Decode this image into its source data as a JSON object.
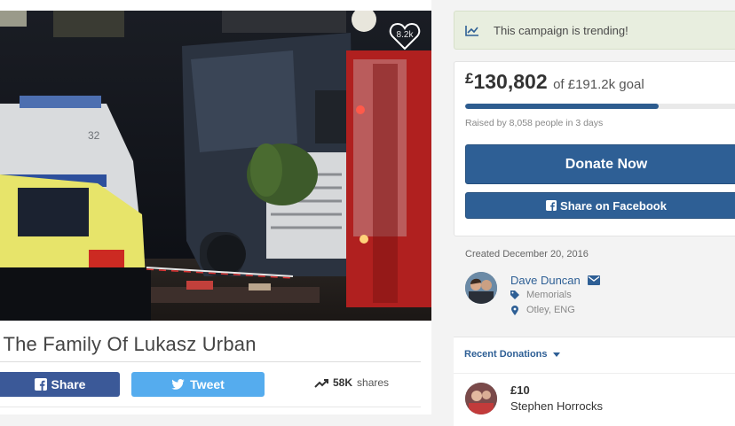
{
  "campaign": {
    "title": "r The Family Of Lukasz Urban",
    "hearts": "8.2k"
  },
  "social": {
    "share_label": "Share",
    "tweet_label": "Tweet",
    "shares_count": "58K",
    "shares_label": "shares"
  },
  "trending": {
    "text": "This campaign is trending!"
  },
  "fundraising": {
    "currency": "£",
    "amount": "130,802",
    "goal_text": "of £191.2k goal",
    "progress_fraction": 0.684,
    "raised_text": "Raised by 8,058 people in 3 days",
    "donate_label": "Donate Now",
    "fb_share_label": "Share on Facebook"
  },
  "organizer": {
    "created": "Created December 20, 2016",
    "name": "Dave Duncan",
    "category": "Memorials",
    "location": "Otley, ENG"
  },
  "recent": {
    "tab_label": "Recent Donations",
    "donations": [
      {
        "amount": "£10",
        "name": "Stephen Horrocks"
      }
    ]
  },
  "colors": {
    "brand_blue": "#2e5f95",
    "facebook": "#3b5998",
    "twitter": "#55acee",
    "trend_bg": "#e8eedf"
  }
}
